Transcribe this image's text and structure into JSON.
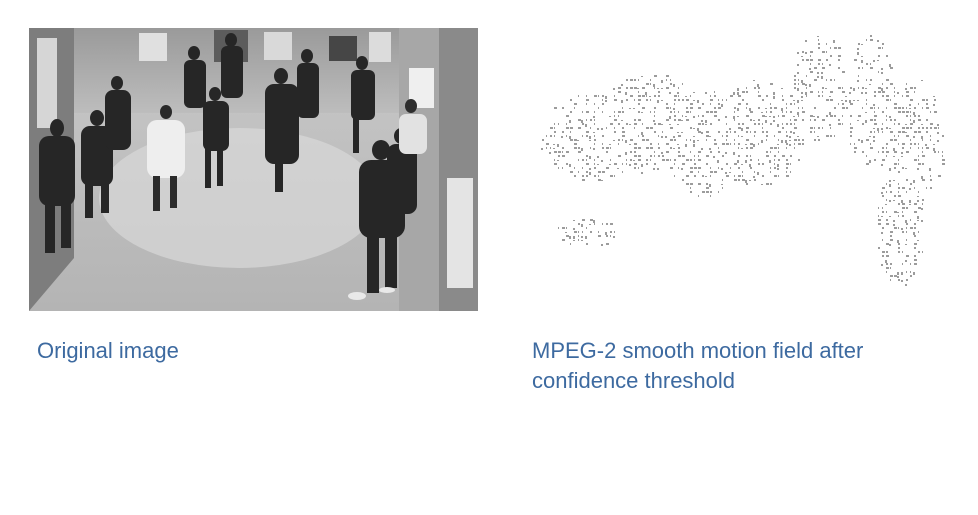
{
  "captions": {
    "left": "Original image",
    "right": "MPEG-2 smooth motion field after confidence threshold"
  },
  "figures": {
    "left_icon": "grayscale-crowd-photo",
    "right_icon": "motion-vector-field"
  },
  "colors": {
    "caption": "#3d6aa0",
    "background": "#ffffff"
  }
}
